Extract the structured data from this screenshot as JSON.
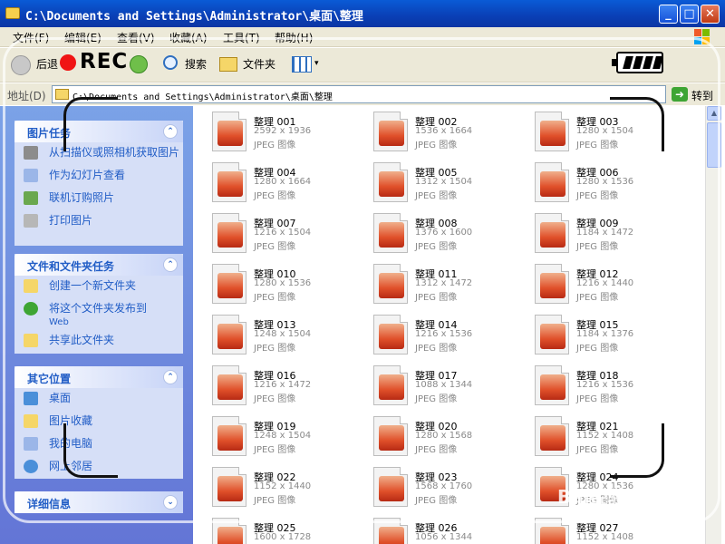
{
  "window": {
    "title": "C:\\Documents and Settings\\Administrator\\桌面\\整理",
    "buttons": {
      "minimize": "_",
      "maximize": "□",
      "close": "✕"
    }
  },
  "menu": [
    "文件(F)",
    "编辑(E)",
    "查看(V)",
    "收藏(A)",
    "工具(T)",
    "帮助(H)"
  ],
  "toolbar": {
    "back": "后退",
    "search": "搜索",
    "folders": "文件夹",
    "rec": "REC"
  },
  "address": {
    "label": "地址(D)",
    "path": "C:\\Documents and Settings\\Administrator\\桌面\\整理",
    "go": "转到"
  },
  "tasks": {
    "picture": {
      "title": "图片任务",
      "items": [
        "从扫描仪或照相机获取图片",
        "作为幻灯片查看",
        "联机订购照片",
        "打印图片"
      ]
    },
    "file": {
      "title": "文件和文件夹任务",
      "items": [
        "创建一个新文件夹",
        "将这个文件夹发布到",
        "共享此文件夹"
      ],
      "publish_sub": "Web"
    },
    "other": {
      "title": "其它位置",
      "items": [
        "桌面",
        "图片收藏",
        "我的电脑",
        "网上邻居"
      ]
    },
    "details": {
      "title": "详细信息"
    }
  },
  "files": [
    {
      "name": "整理 001",
      "dims": "2592 x 1936",
      "type": "JPEG 图像"
    },
    {
      "name": "整理 002",
      "dims": "1536 x 1664",
      "type": "JPEG 图像"
    },
    {
      "name": "整理 003",
      "dims": "1280 x 1504",
      "type": "JPEG 图像"
    },
    {
      "name": "整理 004",
      "dims": "1280 x 1664",
      "type": "JPEG 图像"
    },
    {
      "name": "整理 005",
      "dims": "1312 x 1504",
      "type": "JPEG 图像"
    },
    {
      "name": "整理 006",
      "dims": "1280 x 1536",
      "type": "JPEG 图像"
    },
    {
      "name": "整理 007",
      "dims": "1216 x 1504",
      "type": "JPEG 图像"
    },
    {
      "name": "整理 008",
      "dims": "1376 x 1600",
      "type": "JPEG 图像"
    },
    {
      "name": "整理 009",
      "dims": "1184 x 1472",
      "type": "JPEG 图像"
    },
    {
      "name": "整理 010",
      "dims": "1280 x 1536",
      "type": "JPEG 图像"
    },
    {
      "name": "整理 011",
      "dims": "1312 x 1472",
      "type": "JPEG 图像"
    },
    {
      "name": "整理 012",
      "dims": "1216 x 1440",
      "type": "JPEG 图像"
    },
    {
      "name": "整理 013",
      "dims": "1248 x 1504",
      "type": "JPEG 图像"
    },
    {
      "name": "整理 014",
      "dims": "1216 x 1536",
      "type": "JPEG 图像"
    },
    {
      "name": "整理 015",
      "dims": "1184 x 1376",
      "type": "JPEG 图像"
    },
    {
      "name": "整理 016",
      "dims": "1216 x 1472",
      "type": "JPEG 图像"
    },
    {
      "name": "整理 017",
      "dims": "1088 x 1344",
      "type": "JPEG 图像"
    },
    {
      "name": "整理 018",
      "dims": "1216 x 1536",
      "type": "JPEG 图像"
    },
    {
      "name": "整理 019",
      "dims": "1248 x 1504",
      "type": "JPEG 图像"
    },
    {
      "name": "整理 020",
      "dims": "1280 x 1568",
      "type": "JPEG 图像"
    },
    {
      "name": "整理 021",
      "dims": "1152 x 1408",
      "type": "JPEG 图像"
    },
    {
      "name": "整理 022",
      "dims": "1152 x 1440",
      "type": "JPEG 图像"
    },
    {
      "name": "整理 023",
      "dims": "1568 x 1760",
      "type": "JPEG 图像"
    },
    {
      "name": "整理 024",
      "dims": "1280 x 1536",
      "type": "JPEG 图像"
    },
    {
      "name": "整理 025",
      "dims": "1600 x 1728",
      "type": "JPEG 图像"
    },
    {
      "name": "整理 026",
      "dims": "1056 x 1344",
      "type": "JPEG 图像"
    },
    {
      "name": "整理 027",
      "dims": "1152 x 1408",
      "type": "JPEG 图像"
    }
  ],
  "watermark": {
    "text": "Bai经验",
    "sub": "jingyan.baidu.com"
  }
}
